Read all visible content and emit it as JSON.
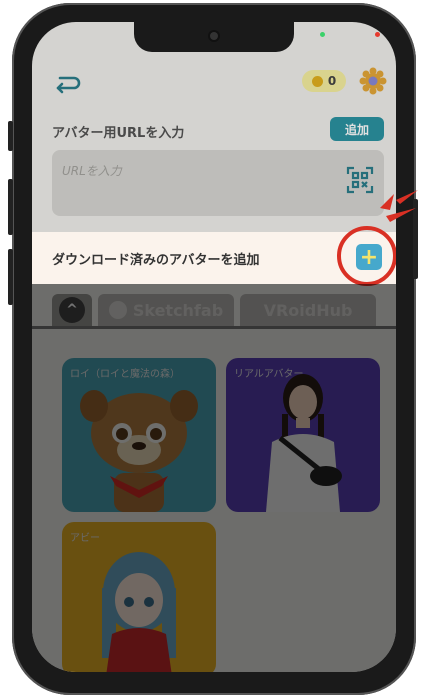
{
  "header": {
    "coin_count": "0"
  },
  "url_section": {
    "label": "アバター用URLを入力",
    "add_button": "追加",
    "input_placeholder": "URLを入力"
  },
  "download_section": {
    "label": "ダウンロード済みのアバターを追加",
    "plus_glyph": "+"
  },
  "tabs": [
    {
      "label": "^"
    },
    {
      "label": "Sketchfab"
    },
    {
      "label": "VRoidHub"
    }
  ],
  "avatars": [
    {
      "name": "ロイ（ロイと魔法の森）"
    },
    {
      "name": "リアルアバター"
    },
    {
      "name": "アビー"
    }
  ],
  "colors": {
    "accent": "#2c95a3",
    "highlight": "#d93024"
  },
  "icons": [
    "back-icon",
    "coin-icon",
    "gear-icon",
    "qr-icon",
    "plus-icon",
    "vr-icon",
    "sketchfab-icon"
  ]
}
